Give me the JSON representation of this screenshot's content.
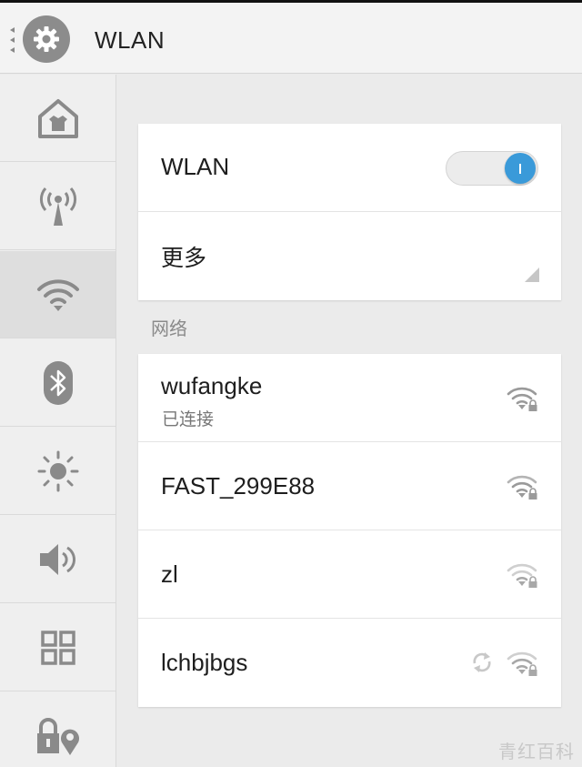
{
  "header": {
    "title": "WLAN",
    "app_icon": "gear-icon"
  },
  "sidebar": {
    "items": [
      {
        "icon": "home-icon",
        "active": false
      },
      {
        "icon": "broadcast-tower-icon",
        "active": false
      },
      {
        "icon": "wifi-icon",
        "active": true
      },
      {
        "icon": "bluetooth-icon",
        "active": false
      },
      {
        "icon": "brightness-icon",
        "active": false
      },
      {
        "icon": "volume-icon",
        "active": false
      },
      {
        "icon": "apps-grid-icon",
        "active": false
      },
      {
        "icon": "lock-location-icon",
        "active": false
      }
    ]
  },
  "settings": {
    "wlan_label": "WLAN",
    "wlan_enabled": true,
    "more_label": "更多"
  },
  "networks_section": {
    "label": "网络",
    "items": [
      {
        "name": "wufangke",
        "status": "已连接",
        "secured": true
      },
      {
        "name": "FAST_299E88",
        "status": "",
        "secured": true
      },
      {
        "name": "zl",
        "status": "",
        "secured": true
      },
      {
        "name": "lchbjbgs",
        "status": "",
        "secured": true,
        "syncing": true
      }
    ]
  },
  "watermark": "青红百科",
  "colors": {
    "accent": "#3a9ad9",
    "background": "#ebebeb",
    "card": "#ffffff"
  }
}
